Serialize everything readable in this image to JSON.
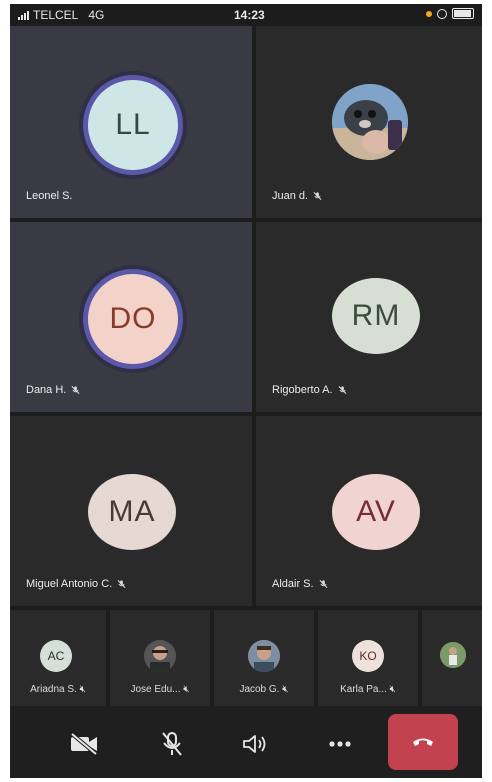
{
  "status_bar": {
    "carrier": "TELCEL",
    "network": "4G",
    "time": "14:23"
  },
  "tiles": [
    {
      "initials": "LL",
      "name": "Leonel S.",
      "muted": false,
      "avatar_color": "#cfe6e6",
      "text_color": "#2d4b4b",
      "active": true
    },
    {
      "initials": "",
      "name": "Juan d.",
      "muted": true,
      "avatar_icon": "photo-avatar",
      "active": false
    },
    {
      "initials": "DO",
      "name": "Dana H.",
      "muted": true,
      "avatar_color": "#f3d3c9",
      "text_color": "#8a3a2a",
      "active": true
    },
    {
      "initials": "RM",
      "name": "Rigoberto A.",
      "muted": true,
      "avatar_color": "#d7dfd5",
      "text_color": "#3d4d3d",
      "active": false
    },
    {
      "initials": "MA",
      "name": "Miguel Antonio C.",
      "muted": true,
      "avatar_color": "#e6d8d2",
      "text_color": "#4a3a35",
      "active": false
    },
    {
      "initials": "AV",
      "name": "Aldair S.",
      "muted": true,
      "avatar_color": "#f0d4d2",
      "text_color": "#7a2c35",
      "active": false
    }
  ],
  "strip": [
    {
      "initials": "AC",
      "name": "Ariadna S.",
      "muted": true,
      "avatar_color": "#d5e0d8"
    },
    {
      "initials": "",
      "name": "Jose Edu...",
      "muted": true,
      "avatar_icon": "photo-avatar"
    },
    {
      "initials": "",
      "name": "Jacob G.",
      "muted": true,
      "avatar_icon": "photo-avatar"
    },
    {
      "initials": "KO",
      "name": "Karla Pa...",
      "muted": true,
      "avatar_color": "#efe1de"
    },
    {
      "initials": "",
      "name": "",
      "muted": false,
      "avatar_icon": "photo-avatar"
    }
  ],
  "controls": {
    "camera_icon": "camera-off-icon",
    "mic_icon": "mic-off-icon",
    "speaker_icon": "speaker-icon",
    "more_icon": "more-icon",
    "end_icon": "hangup-icon",
    "end_color": "#c4414f"
  }
}
